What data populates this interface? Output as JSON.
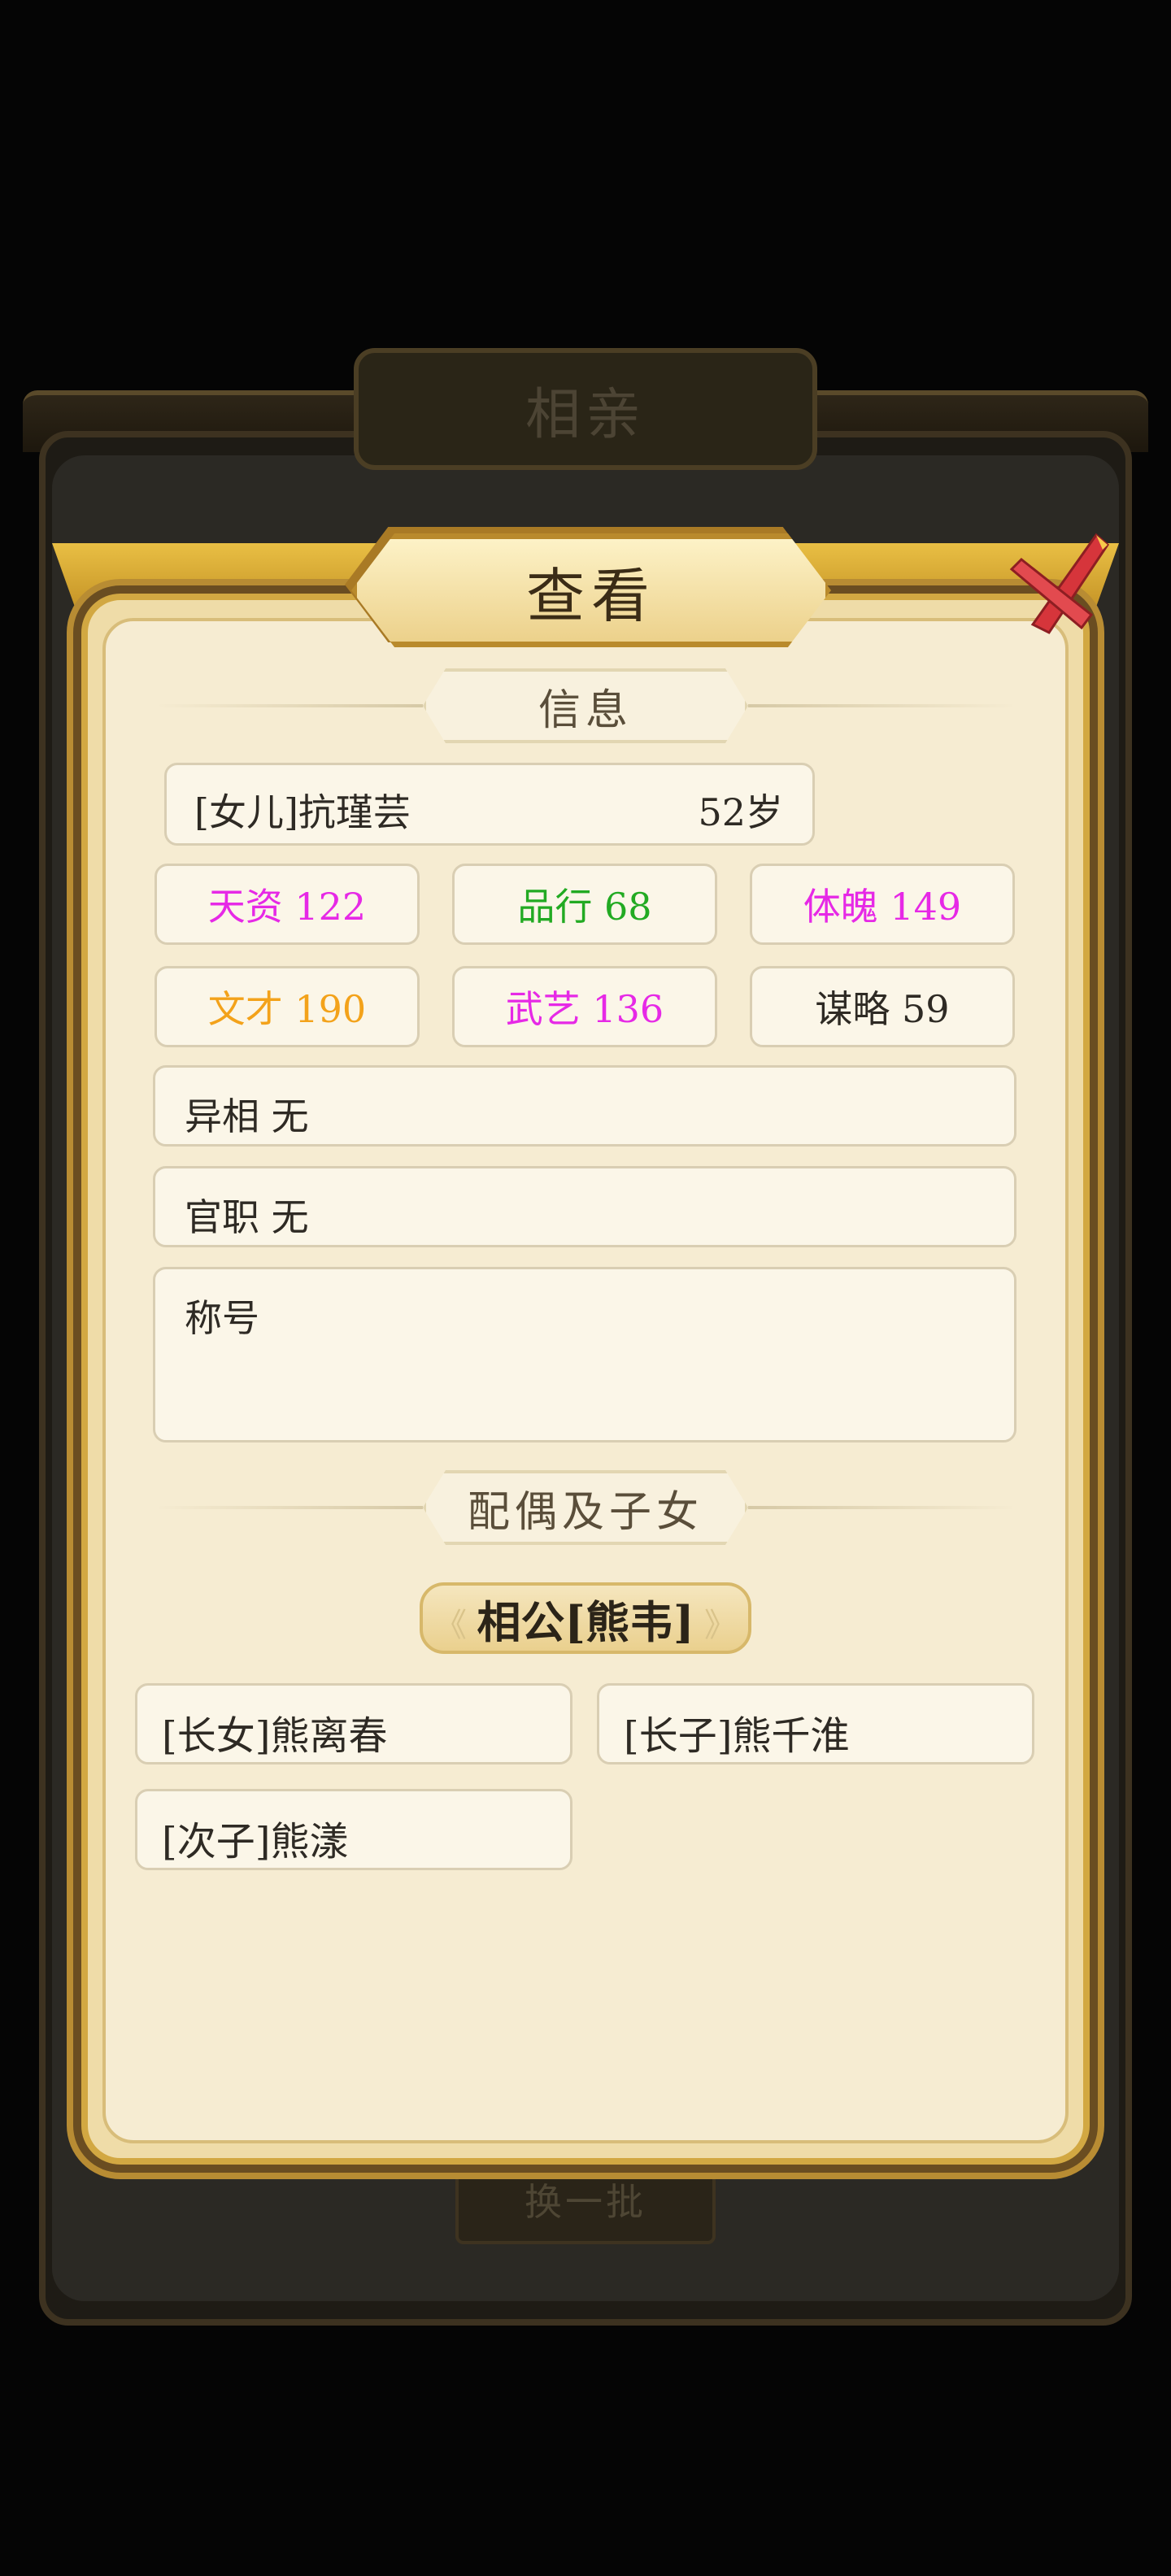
{
  "background": {
    "title": "相亲",
    "bottom_button": "换一批"
  },
  "popup": {
    "title": "查看",
    "close_icon": "close-x-icon",
    "info_section_title": "信息",
    "person": {
      "name": "[女儿]抗瑾芸",
      "age": "52岁"
    },
    "stats": [
      {
        "label": "天资 122",
        "color": "#e629e6"
      },
      {
        "label": "品行 68",
        "color": "#22aa22"
      },
      {
        "label": "体魄 149",
        "color": "#e629e6"
      },
      {
        "label": "文才 190",
        "color": "#f3a21a"
      },
      {
        "label": "武艺 136",
        "color": "#e629e6"
      },
      {
        "label": "谋略 59",
        "color": "#2e2a24"
      }
    ],
    "aberration": "异相 无",
    "official_post": "官职 无",
    "titles_label": "称号",
    "family_section_title": "配偶及子女",
    "spouse": "相公[熊韦]",
    "children": [
      "[长女]熊离春",
      "[长子]熊千淮",
      "[次子]熊漾"
    ]
  }
}
